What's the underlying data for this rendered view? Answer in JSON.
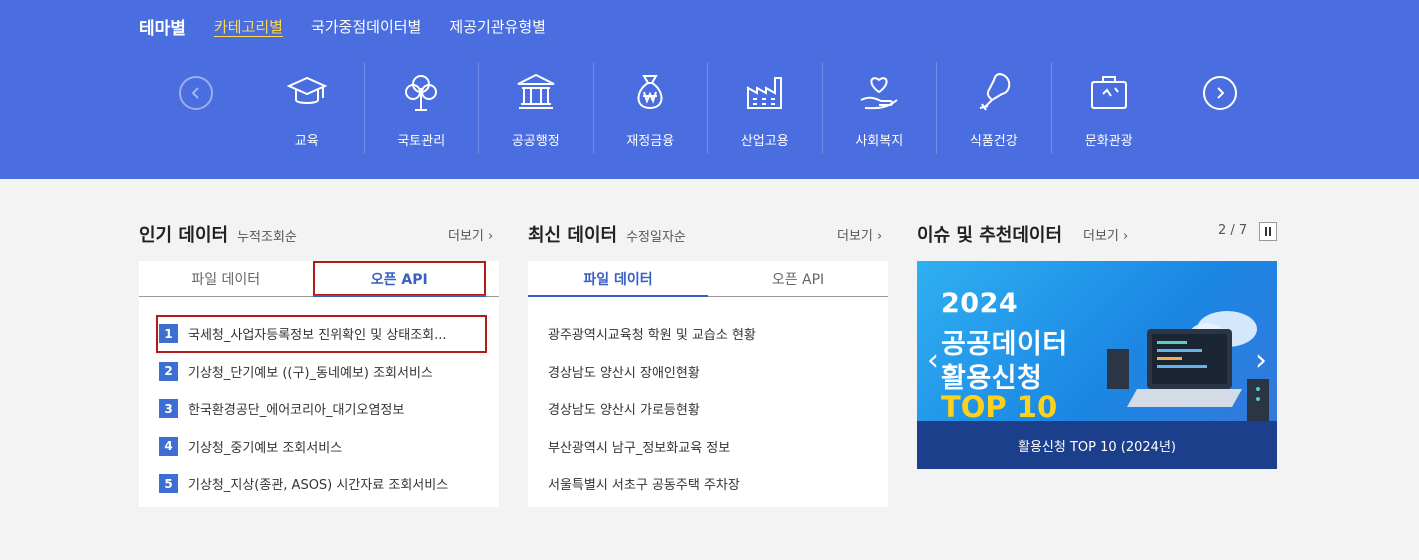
{
  "header": {
    "title": "테마별",
    "tabs": [
      "카테고리별",
      "국가중점데이터별",
      "제공기관유형별"
    ],
    "active_tab": 0
  },
  "categories": [
    {
      "label": "교육",
      "icon": "graduation-cap-icon"
    },
    {
      "label": "국토관리",
      "icon": "tree-icon"
    },
    {
      "label": "공공행정",
      "icon": "government-building-icon"
    },
    {
      "label": "재정금융",
      "icon": "money-bag-icon"
    },
    {
      "label": "산업고용",
      "icon": "factory-icon"
    },
    {
      "label": "사회복지",
      "icon": "heart-hand-icon"
    },
    {
      "label": "식품건강",
      "icon": "chicken-leg-icon"
    },
    {
      "label": "문화관광",
      "icon": "suitcase-icon"
    }
  ],
  "popular": {
    "title": "인기 데이터",
    "subtitle": "누적조회순",
    "more": "더보기",
    "tabs": [
      "파일 데이터",
      "오픈 API"
    ],
    "active_tab": 1,
    "items": [
      "국세청_사업자등록정보 진위확인 및 상태조회...",
      "기상청_단기예보 ((구)_동네예보) 조회서비스",
      "한국환경공단_에어코리아_대기오염정보",
      "기상청_중기예보 조회서비스",
      "기상청_지상(종관, ASOS) 시간자료 조회서비스"
    ]
  },
  "latest": {
    "title": "최신 데이터",
    "subtitle": "수정일자순",
    "more": "더보기",
    "tabs": [
      "파일 데이터",
      "오픈 API"
    ],
    "active_tab": 0,
    "items": [
      "광주광역시교육청 학원 및 교습소 현황",
      "경상남도 양산시 장애인현황",
      "경상남도 양산시 가로등현황",
      "부산광역시 남구_정보화교육 정보",
      "서울특별시 서초구 공동주택 주차장"
    ]
  },
  "issue": {
    "title": "이슈 및 추천데이터",
    "more": "더보기",
    "pager": "2 / 7",
    "banner_lines": [
      "2024",
      "공공데이터",
      "활용신청"
    ],
    "banner_highlight": "TOP 10",
    "banner_caption": "활용신청 TOP 10 (2024년)"
  },
  "colors": {
    "header_bg": "#4a6ddf",
    "active_tab": "#ffd84a",
    "accent": "#3760c6",
    "highlight_border": "#b31b1b"
  }
}
